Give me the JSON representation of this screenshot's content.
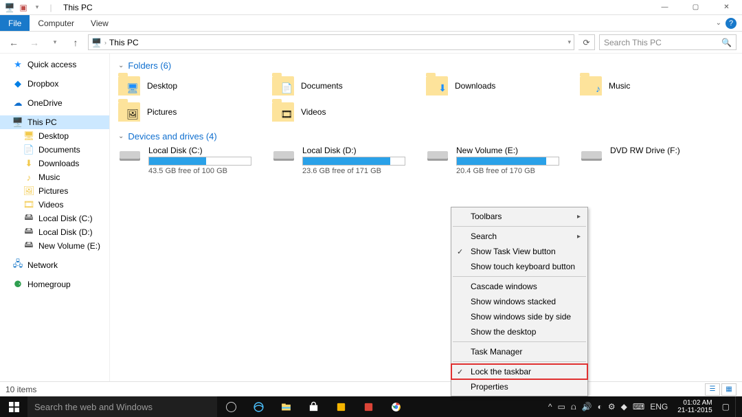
{
  "titlebar": {
    "title": "This PC"
  },
  "ribbon": {
    "tabs": {
      "file": "File",
      "computer": "Computer",
      "view": "View"
    }
  },
  "addr": {
    "crumb": "This PC",
    "search_placeholder": "Search This PC"
  },
  "nav": {
    "quick_access": "Quick access",
    "dropbox": "Dropbox",
    "onedrive": "OneDrive",
    "this_pc": "This PC",
    "children": {
      "desktop": "Desktop",
      "documents": "Documents",
      "downloads": "Downloads",
      "music": "Music",
      "pictures": "Pictures",
      "videos": "Videos",
      "localc": "Local Disk (C:)",
      "locald": "Local Disk (D:)",
      "newvol": "New Volume (E:)"
    },
    "network": "Network",
    "homegroup": "Homegroup"
  },
  "sections": {
    "folders_hdr": "Folders (6)",
    "drives_hdr": "Devices and drives (4)"
  },
  "folders": [
    {
      "name": "Desktop"
    },
    {
      "name": "Documents"
    },
    {
      "name": "Downloads"
    },
    {
      "name": "Music"
    },
    {
      "name": "Pictures"
    },
    {
      "name": "Videos"
    }
  ],
  "drives": [
    {
      "name": "Local Disk (C:)",
      "free": "43.5 GB free of 100 GB",
      "fill_pct": 56
    },
    {
      "name": "Local Disk (D:)",
      "free": "23.6 GB free of 171 GB",
      "fill_pct": 86
    },
    {
      "name": "New Volume (E:)",
      "free": "20.4 GB free of 170 GB",
      "fill_pct": 88
    },
    {
      "name": "DVD RW Drive (F:)",
      "free": "",
      "fill_pct": -1
    }
  ],
  "status": {
    "items": "10 items"
  },
  "taskbar": {
    "search_placeholder": "Search the web and Windows",
    "lang": "ENG",
    "time": "01:02 AM",
    "date": "21-11-2015"
  },
  "ctx": {
    "toolbars": "Toolbars",
    "search": "Search",
    "show_task_view": "Show Task View button",
    "show_touch_kb": "Show touch keyboard button",
    "cascade": "Cascade windows",
    "stacked": "Show windows stacked",
    "sidebyside": "Show windows side by side",
    "show_desktop": "Show the desktop",
    "task_manager": "Task Manager",
    "lock_taskbar": "Lock the taskbar",
    "properties": "Properties"
  }
}
